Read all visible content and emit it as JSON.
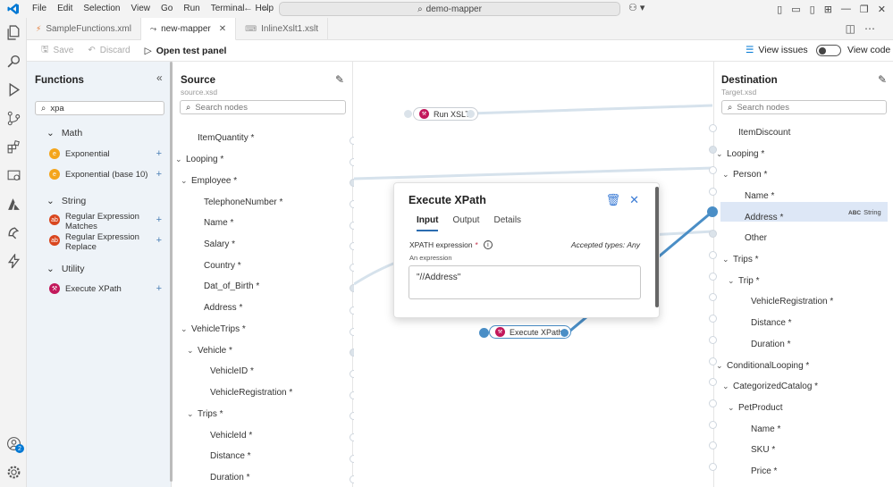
{
  "titlebar": {
    "menu": [
      "File",
      "Edit",
      "Selection",
      "View",
      "Go",
      "Run",
      "Terminal",
      "Help"
    ],
    "search": "demo-mapper"
  },
  "tabs": [
    {
      "label": "SampleFunctions.xml",
      "active": false
    },
    {
      "label": "new-mapper",
      "active": true
    },
    {
      "label": "InlineXslt1.xslt",
      "active": false
    }
  ],
  "toolbar": {
    "save": "Save",
    "discard": "Discard",
    "open_test_panel": "Open test panel",
    "view_issues": "View issues",
    "view_code": "View code"
  },
  "functions": {
    "title": "Functions",
    "search_value": "xpa",
    "groups": [
      {
        "name": "Math",
        "items": [
          {
            "label": "Exponential",
            "color": "#f4a51c"
          },
          {
            "label": "Exponential (base 10)",
            "color": "#f4a51c"
          }
        ]
      },
      {
        "name": "String",
        "items": [
          {
            "label_line1": "Regular Expression",
            "label_line2": "Matches",
            "color": "#d9461e"
          },
          {
            "label_line1": "Regular Expression",
            "label_line2": "Replace",
            "color": "#d9461e"
          }
        ]
      },
      {
        "name": "Utility",
        "items": [
          {
            "label": "Execute XPath",
            "color": "#c2185b"
          }
        ]
      }
    ]
  },
  "source": {
    "title": "Source",
    "subtitle": "source.xsd",
    "search_placeholder": "Search nodes",
    "nodes": [
      "ItemQuantity *",
      "Looping *",
      "Employee *",
      "TelephoneNumber *",
      "Name *",
      "Salary *",
      "Country *",
      "Dat_of_Birth *",
      "Address *",
      "VehicleTrips *",
      "Vehicle *",
      "VehicleID *",
      "VehicleRegistration *",
      "Trips *",
      "VehicleId *",
      "Distance *",
      "Duration *"
    ]
  },
  "canvas": {
    "run_xslt": "Run XSLT",
    "execute_xpath": "Execute XPath"
  },
  "dialog": {
    "title": "Execute XPath",
    "tabs": [
      "Input",
      "Output",
      "Details"
    ],
    "xpath_label": "XPATH expression",
    "required_mark": "*",
    "accepted_types": "Accepted types: Any",
    "hint": "An expression",
    "value": "\"//Address\""
  },
  "destination": {
    "title": "Destination",
    "subtitle": "Target.xsd",
    "search_placeholder": "Search nodes",
    "nodes": [
      "ItemDiscount",
      "Looping *",
      "Person *",
      "Name *",
      "Address *",
      "Other",
      "Trips *",
      "Trip *",
      "VehicleRegistration *",
      "Distance *",
      "Duration *",
      "ConditionalLooping *",
      "CategorizedCatalog *",
      "PetProduct",
      "Name *",
      "SKU *",
      "Price *"
    ],
    "type_badge": "ABC",
    "type_label": "String"
  },
  "activity": {
    "badge": "2"
  },
  "colors": {
    "accent": "#0078d4",
    "link": "#4a8ec6",
    "line": "#d6e2ec"
  }
}
